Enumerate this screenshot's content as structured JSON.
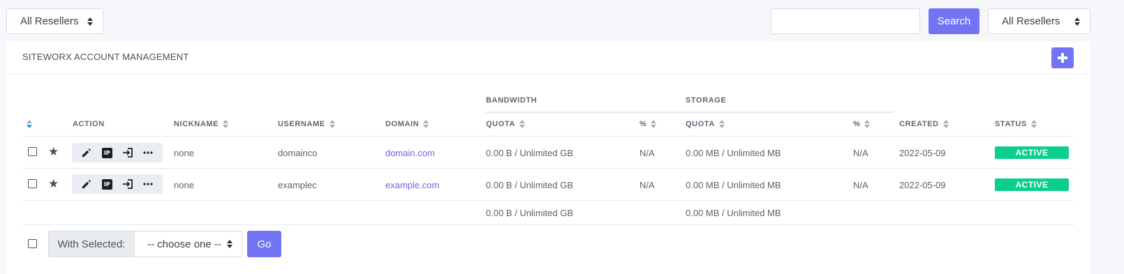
{
  "toolbar": {
    "reseller_filter_left": "All Resellers",
    "search_placeholder": "",
    "search_label": "Search",
    "reseller_filter_right": "All Resellers"
  },
  "panel": {
    "title": "SITEWORX ACCOUNT MANAGEMENT",
    "add_icon": "plus-icon"
  },
  "table": {
    "group_headers": {
      "bandwidth": "BANDWIDTH",
      "storage": "STORAGE"
    },
    "columns": {
      "action": "ACTION",
      "nickname": "NICKNAME",
      "username": "USERNAME",
      "domain": "DOMAIN",
      "bw_quota": "QUOTA",
      "bw_pct": "%",
      "st_quota": "QUOTA",
      "st_pct": "%",
      "created": "CREATED",
      "status": "STATUS"
    },
    "action_icons": [
      "pencil-icon",
      "ip-icon",
      "login-icon",
      "more-icon"
    ],
    "ip_icon_text": "IP",
    "rows": [
      {
        "nickname": "none",
        "username": "domainco",
        "domain": "domain.com",
        "bw_quota": "0.00 B / Unlimited GB",
        "bw_pct": "N/A",
        "st_quota": "0.00 MB / Unlimited MB",
        "st_pct": "N/A",
        "created": "2022-05-09",
        "status": "ACTIVE"
      },
      {
        "nickname": "none",
        "username": "examplec",
        "domain": "example.com",
        "bw_quota": "0.00 B / Unlimited GB",
        "bw_pct": "N/A",
        "st_quota": "0.00 MB / Unlimited MB",
        "st_pct": "N/A",
        "created": "2022-05-09",
        "status": "ACTIVE"
      }
    ],
    "totals": {
      "bw_quota": "0.00 B / Unlimited GB",
      "st_quota": "0.00 MB / Unlimited MB"
    }
  },
  "bulk": {
    "with_selected_label": "With Selected:",
    "selected_option": "-- choose one --",
    "go_label": "Go"
  },
  "colors": {
    "accent": "#7274f3",
    "status_active": "#0ccf8d",
    "link": "#6466e8"
  }
}
